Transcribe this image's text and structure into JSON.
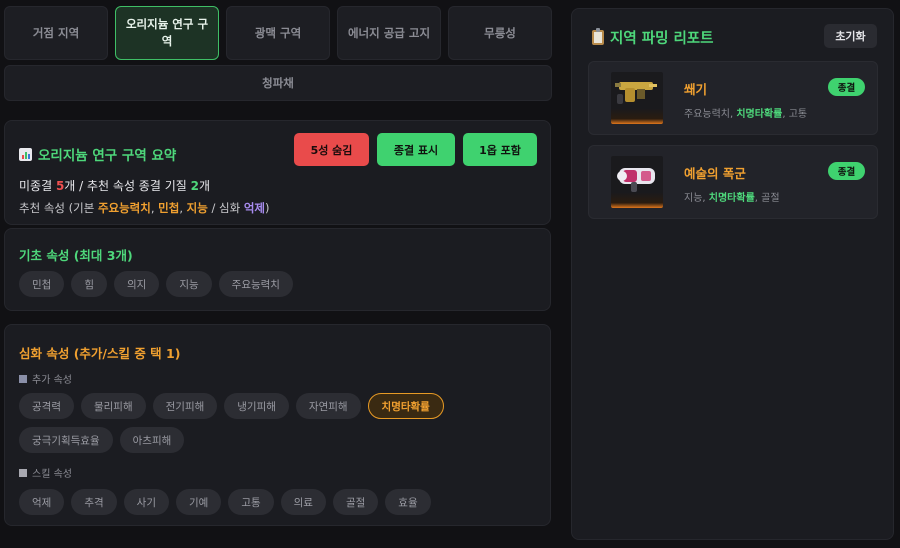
{
  "tabs": [
    "거점 지역",
    "오리지늄 연구 구역",
    "광맥 구역",
    "에너지 공급 고지",
    "무릉성"
  ],
  "active_tab_index": 1,
  "tab_wide": "청파채",
  "summary": {
    "title": "오리지늄 연구 구역 요약",
    "buttons": {
      "hide_5star": "5성 숨김",
      "show_final": "종결 표시",
      "include_1": "1옵 포함"
    },
    "line1": {
      "pre": "미종결 ",
      "count1": "5",
      "mid": "개 / 추천 속성 종결 기질 ",
      "count2": "2",
      "post": "개"
    },
    "line2": {
      "pre": "추천 속성 (기본 ",
      "attr1": "주요능력치",
      "sep1": ", ",
      "attr2": "민첩",
      "sep2": ", ",
      "attr3": "지능",
      "mid": " / 심화 ",
      "attr4": "억제",
      "post": ")"
    }
  },
  "basic": {
    "title": "기초 속성 (최대 3개)",
    "chips": [
      "민첩",
      "힘",
      "의지",
      "지능",
      "주요능력치"
    ]
  },
  "advanced": {
    "title": "심화 속성 (추가/스킬 중 택 1)",
    "extra_label": "추가 속성",
    "extra_chips": [
      "공격력",
      "물리피해",
      "전기피해",
      "냉기피해",
      "자연피해",
      "치명타확률",
      "궁극기획득효율",
      "아츠피해"
    ],
    "selected_chip": "치명타확률",
    "skill_label": "스킬 속성",
    "skill_chips": [
      "억제",
      "추격",
      "사기",
      "기예",
      "고통",
      "의료",
      "골절",
      "효율"
    ]
  },
  "report": {
    "title": "지역 파밍 리포트",
    "reset": "초기화",
    "items": [
      {
        "name": "쐐기",
        "badge": "종결",
        "tag1": "주요능력치",
        "tag2": "치명타확률",
        "tag3": "고통",
        "sep": ", ",
        "icon": "gun-icon"
      },
      {
        "name": "예술의 폭군",
        "badge": "종결",
        "tag1": "지능",
        "tag2": "치명타확률",
        "tag3": "골절",
        "sep": ", ",
        "icon": "cannon-icon"
      }
    ]
  },
  "colors": {
    "accent_green": "#4ed77b",
    "accent_orange": "#f0a030",
    "red": "#e94b4b",
    "purple": "#a88cf0",
    "bg": "#111114",
    "card": "#1b1c21"
  }
}
